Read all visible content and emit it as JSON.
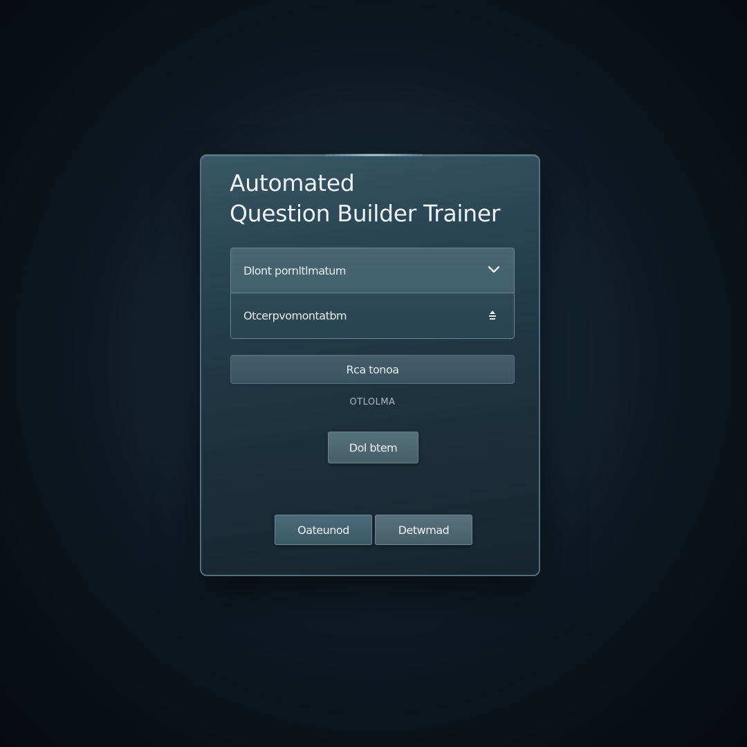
{
  "dialog": {
    "title_line1": "Automated",
    "title_line2": "Question Builder Trainer"
  },
  "selects": [
    {
      "label": "Dlont pornltlmatum",
      "icon": "chevron-down-icon"
    },
    {
      "label": "Otcerpvomontatbm",
      "icon": "up-down-stepper-icon"
    }
  ],
  "wide_button": {
    "label": "Rca tonoa"
  },
  "status_text": "OTLOLMA",
  "mid_button": {
    "label": "Dol btem"
  },
  "footer_buttons": {
    "left_label": "Oateunod",
    "right_label": "Detwmad"
  },
  "colors": {
    "background": "#0d1820",
    "panel": "#1f3542",
    "panel_border": "#52707f",
    "text": "#eef3f6"
  }
}
